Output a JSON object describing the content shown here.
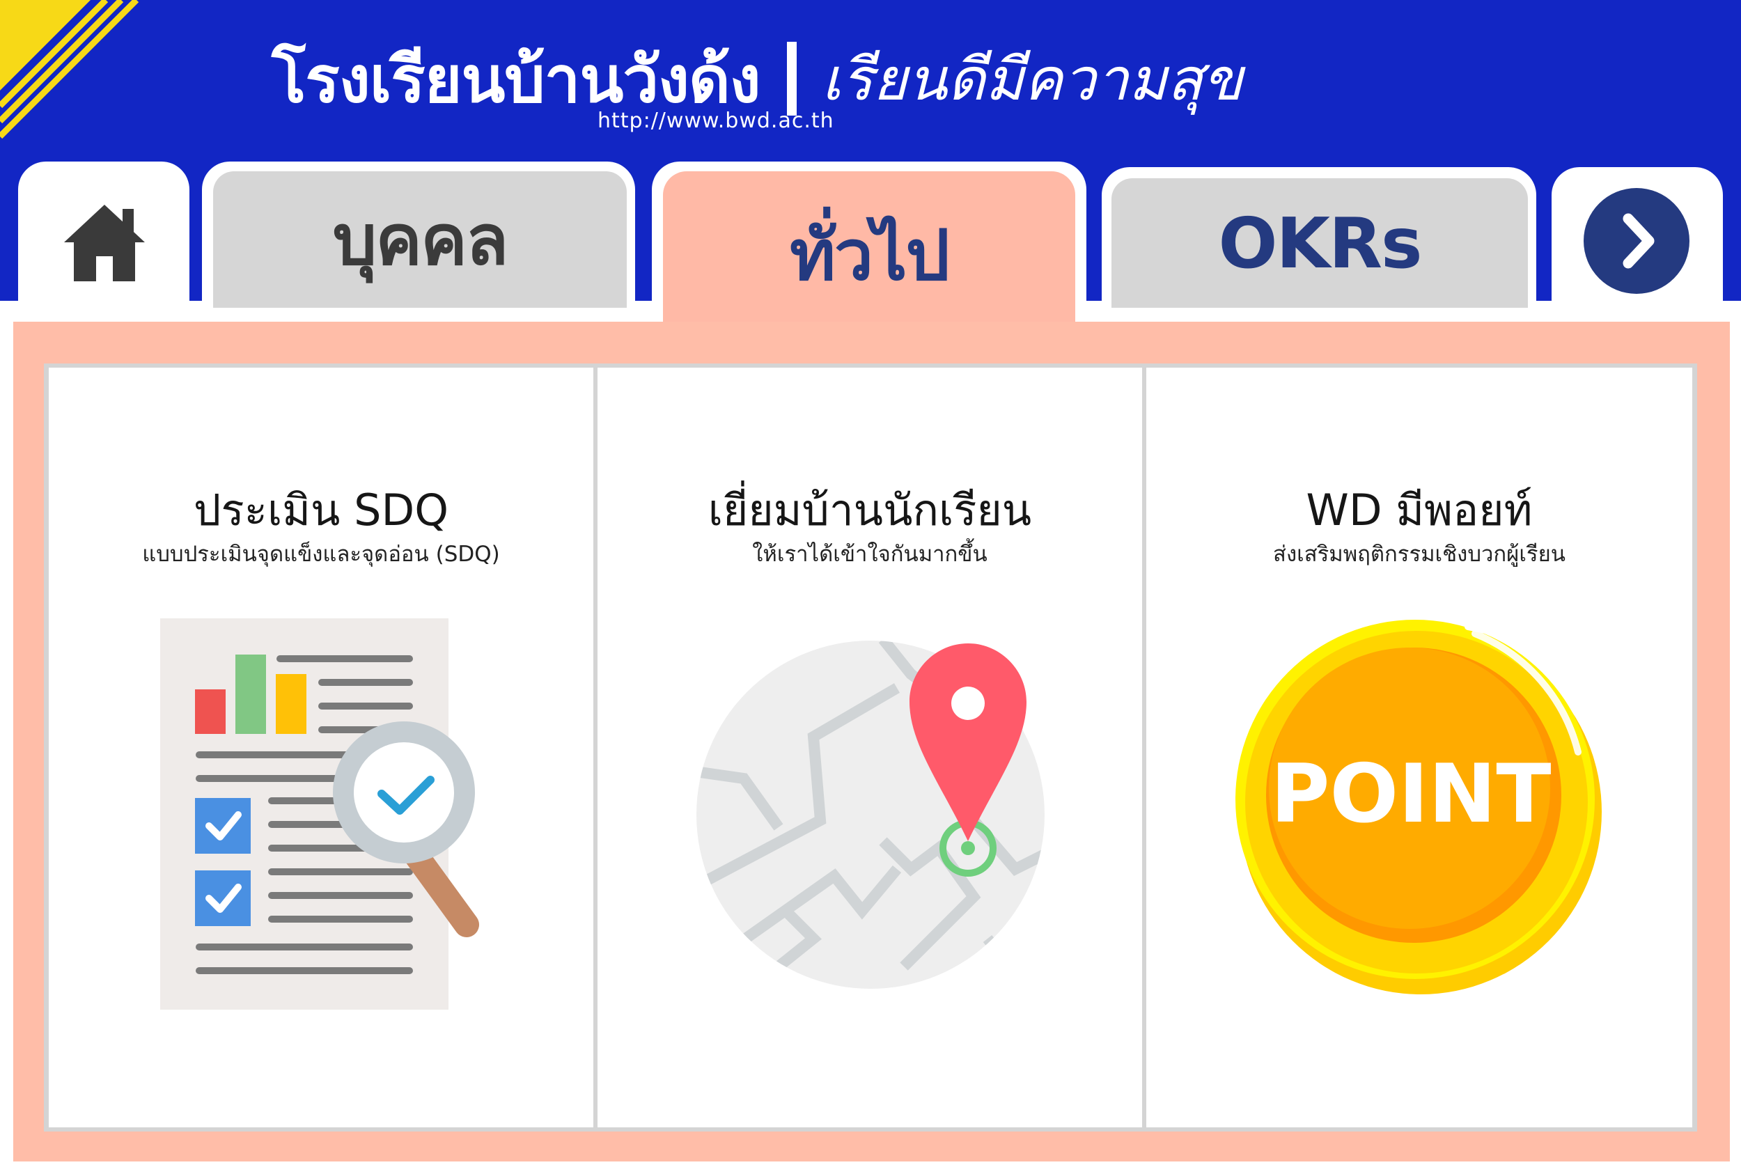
{
  "header": {
    "school_name": "โรงเรียนบ้านวังด้ง",
    "motto": "เรียนดีมีความสุข",
    "url": "http://www.bwd.ac.th"
  },
  "tabs": [
    {
      "label": "",
      "icon": "home-icon",
      "active": false
    },
    {
      "label": "บุคคล",
      "active": false
    },
    {
      "label": "ทั่วไป",
      "active": true
    },
    {
      "label": "OKRs",
      "active": false
    },
    {
      "label": "",
      "icon": "chevron-right-icon",
      "active": false
    }
  ],
  "cards": [
    {
      "title": "ประเมิน SDQ",
      "subtitle": "แบบประเมินจุดแข็งและจุดอ่อน (SDQ)",
      "icon": "report-magnifier-icon"
    },
    {
      "title": "เยี่ยมบ้านนักเรียน",
      "subtitle": "ให้เราได้เข้าใจกันมากขึ้น",
      "icon": "map-pin-icon"
    },
    {
      "title": "WD มีพอยท์",
      "subtitle": "ส่งเสริมพฤติกรรมเชิงบวกผู้เรียน",
      "icon": "point-coin-icon",
      "coin_text": "POINT"
    }
  ],
  "colors": {
    "header_bg": "#1226c4",
    "active_tab": "#ffb9a6",
    "inactive_tab": "#d6d6d6",
    "accent_navy": "#243a80",
    "accent_yellow": "#f7d917"
  }
}
